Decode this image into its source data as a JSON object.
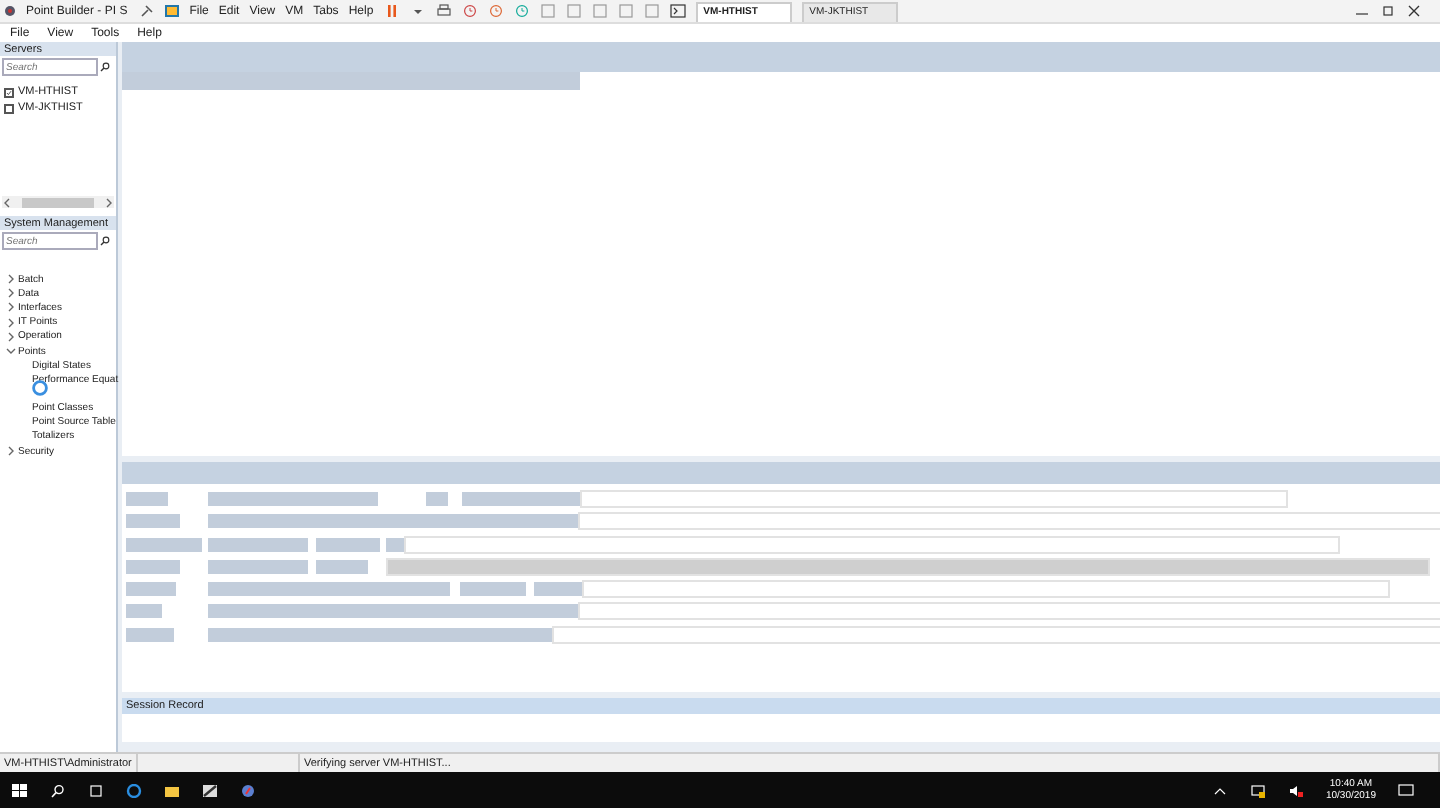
{
  "vm_toolbar": {
    "title": "Point Builder - PI S",
    "menus": [
      "File",
      "Edit",
      "View",
      "VM",
      "Tabs",
      "Help"
    ],
    "tabs": [
      {
        "label": "VM-HTHIST",
        "selected": true
      },
      {
        "label": "VM-JKTHIST",
        "selected": false
      }
    ]
  },
  "app_menu": [
    "File",
    "View",
    "Tools",
    "Help"
  ],
  "servers": {
    "title": "Servers",
    "search": {
      "placeholder": "Search"
    },
    "items": [
      {
        "label": "VM-HTHIST",
        "checked": true
      },
      {
        "label": "VM-JKTHIST",
        "checked": false
      }
    ]
  },
  "system_management": {
    "title": "System Management",
    "search": {
      "placeholder": "Search"
    },
    "tree": [
      {
        "label": "Batch",
        "expanded": false
      },
      {
        "label": "Data",
        "expanded": false
      },
      {
        "label": "Interfaces",
        "expanded": false
      },
      {
        "label": "IT Points",
        "expanded": false
      },
      {
        "label": "Operation",
        "expanded": false
      },
      {
        "label": "Points",
        "expanded": true,
        "children": [
          {
            "label": "Digital States"
          },
          {
            "label": "Performance Equat"
          },
          {
            "label": "Point Classes"
          },
          {
            "label": "Point Source Table"
          },
          {
            "label": "Totalizers"
          }
        ]
      },
      {
        "label": "Security",
        "expanded": false
      }
    ]
  },
  "session_record": {
    "title": "Session Record"
  },
  "status_bar": [
    "VM-HTHIST\\Administrator",
    "Verifying server VM-HTHIST..."
  ],
  "taskbar": {
    "time": "10:40 AM",
    "date": "10/30/2019"
  }
}
